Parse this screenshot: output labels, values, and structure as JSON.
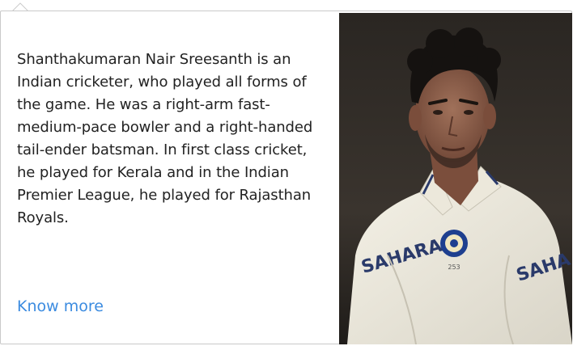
{
  "card": {
    "bio": "Shanthakumaran Nair Sreesanth is an Indian cricketer, who played all forms of the game. He was a right-arm fast-medium-pace bowler and a right-handed tail-ender batsman. In first class cricket, he played for Kerala and in the Indian Premier League, he played for Rajasthan Royals.",
    "link_label": "Know more",
    "photo": {
      "sponsor_text": "SAHARA",
      "sponsor_text_right": "SAHA",
      "shirt_number": "253"
    }
  },
  "colors": {
    "link": "#3b8be0",
    "border": "#c9c9c9"
  }
}
